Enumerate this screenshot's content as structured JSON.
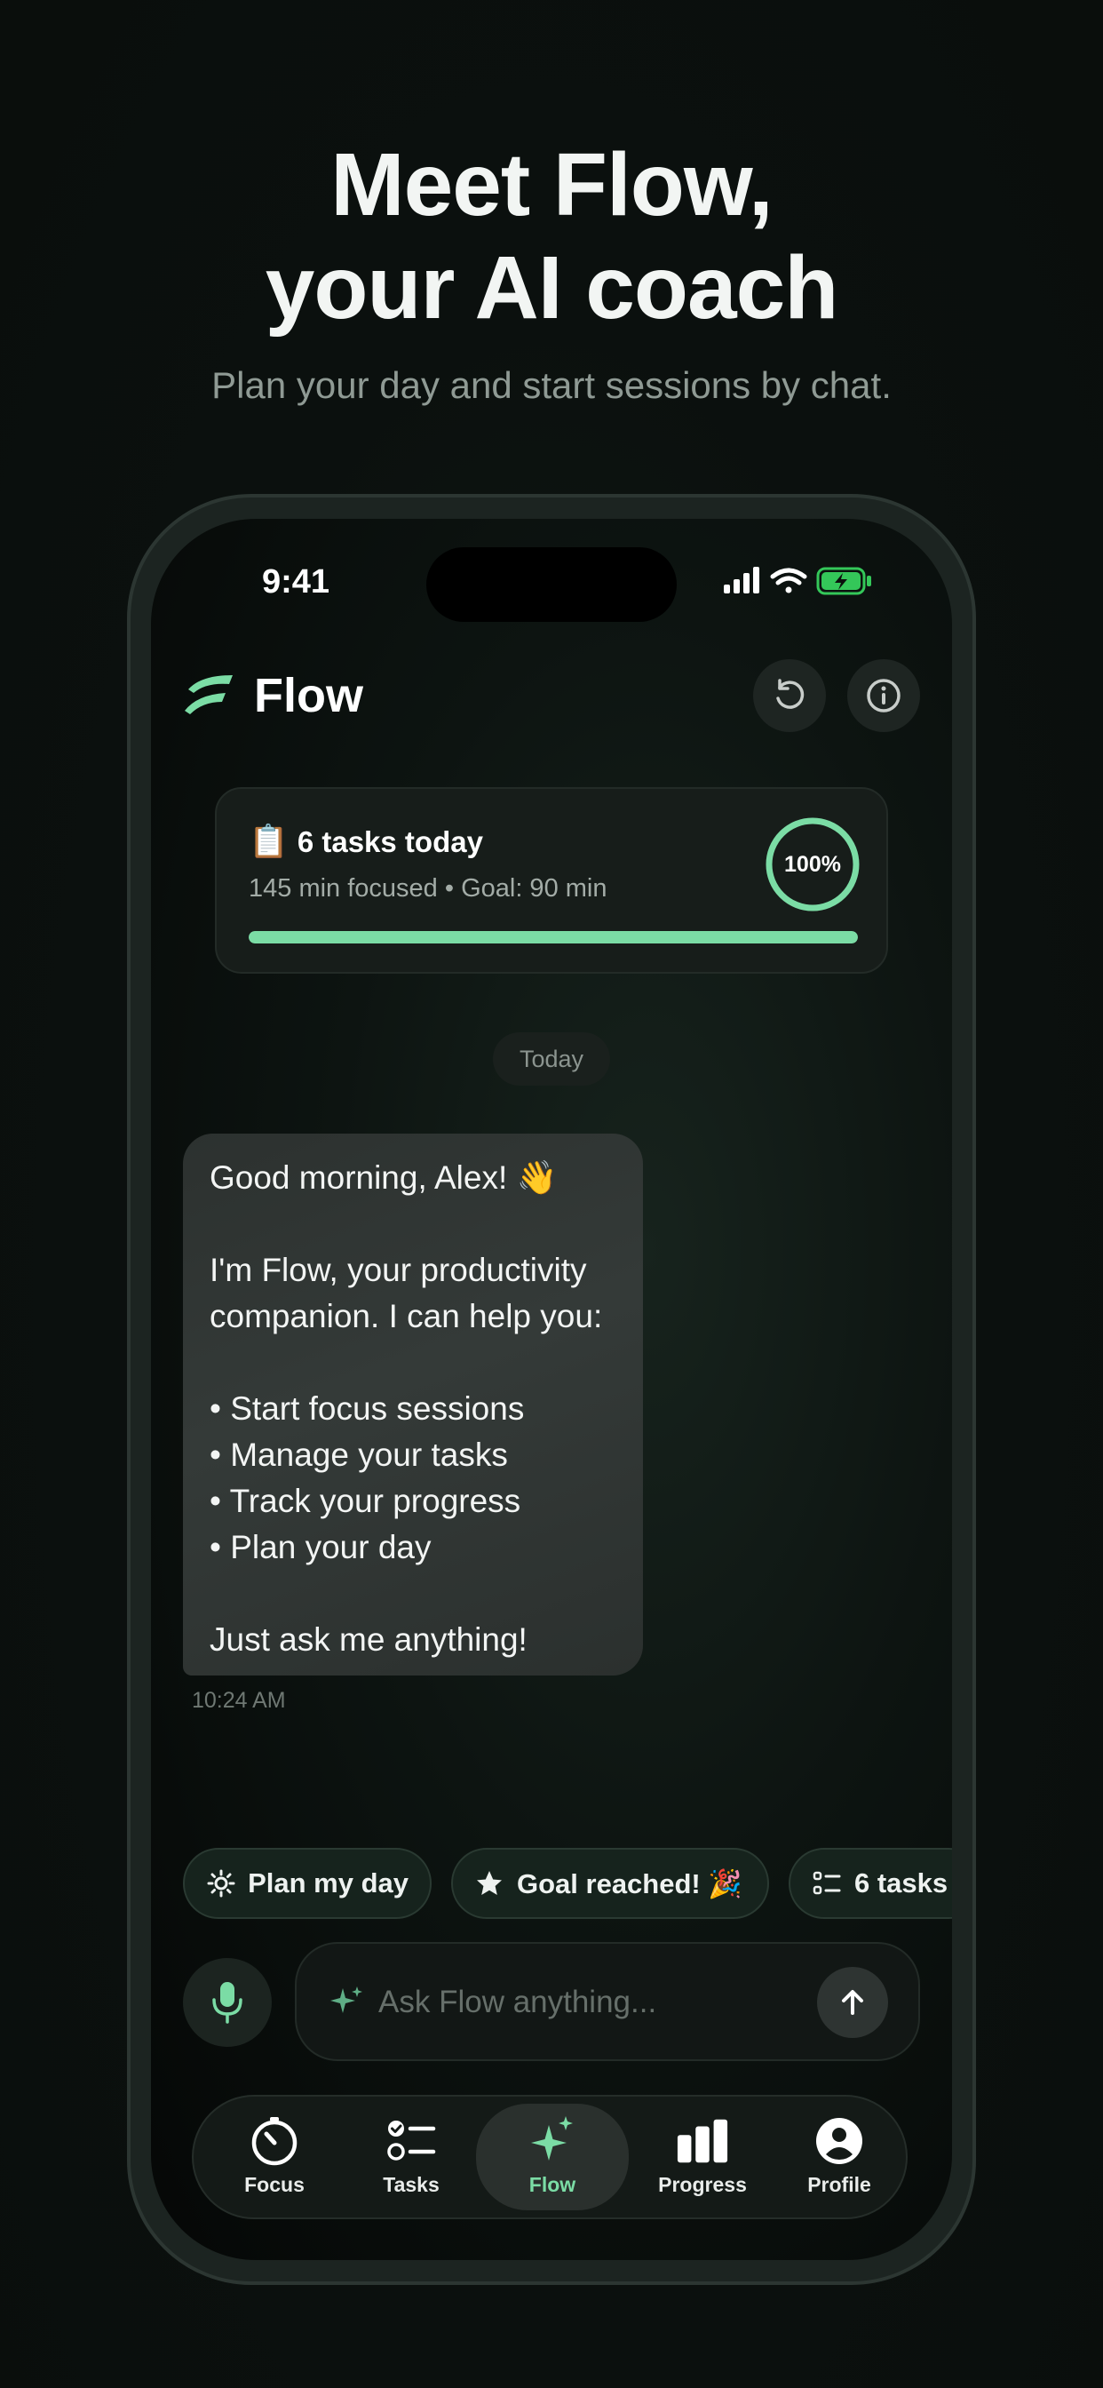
{
  "hero": {
    "title_line1": "Meet Flow,",
    "title_line2": "your AI coach",
    "subtitle": "Plan your day and start sessions by chat."
  },
  "status_bar": {
    "time": "9:41"
  },
  "header": {
    "title": "Flow",
    "logo_icon": "flow-logo-icon",
    "reset_icon": "reset-icon",
    "info_icon": "info-icon"
  },
  "summary": {
    "emoji": "📋",
    "title": "6 tasks today",
    "meta": "145 min focused • Goal: 90 min",
    "progress_label": "100%",
    "progress_fraction": 1.0,
    "accent_color": "#7bdca5"
  },
  "chat": {
    "day_label": "Today",
    "message": {
      "line1": "Good morning, Alex! 👋",
      "line2": "I'm Flow, your productivity",
      "line3": "companion. I can help you:",
      "bullet1": "• Start focus sessions",
      "bullet2": "• Manage your tasks",
      "bullet3": "• Track your progress",
      "bullet4": "• Plan your day",
      "closing": "Just ask me anything!",
      "time": "10:24 AM"
    }
  },
  "suggestions": [
    {
      "label": "Plan my day",
      "icon": "sun-icon"
    },
    {
      "label": "Goal reached! 🎉",
      "icon": "star-icon"
    },
    {
      "label": "6 tasks",
      "icon": "list-icon"
    }
  ],
  "composer": {
    "placeholder": "Ask Flow anything...",
    "mic_icon": "mic-icon",
    "send_icon": "arrow-up-icon"
  },
  "tabs": [
    {
      "label": "Focus",
      "icon": "timer-icon",
      "active": false
    },
    {
      "label": "Tasks",
      "icon": "checklist-icon",
      "active": false
    },
    {
      "label": "Flow",
      "icon": "sparkle-icon",
      "active": true
    },
    {
      "label": "Progress",
      "icon": "bar-chart-icon",
      "active": false
    },
    {
      "label": "Profile",
      "icon": "person-icon",
      "active": false
    }
  ]
}
